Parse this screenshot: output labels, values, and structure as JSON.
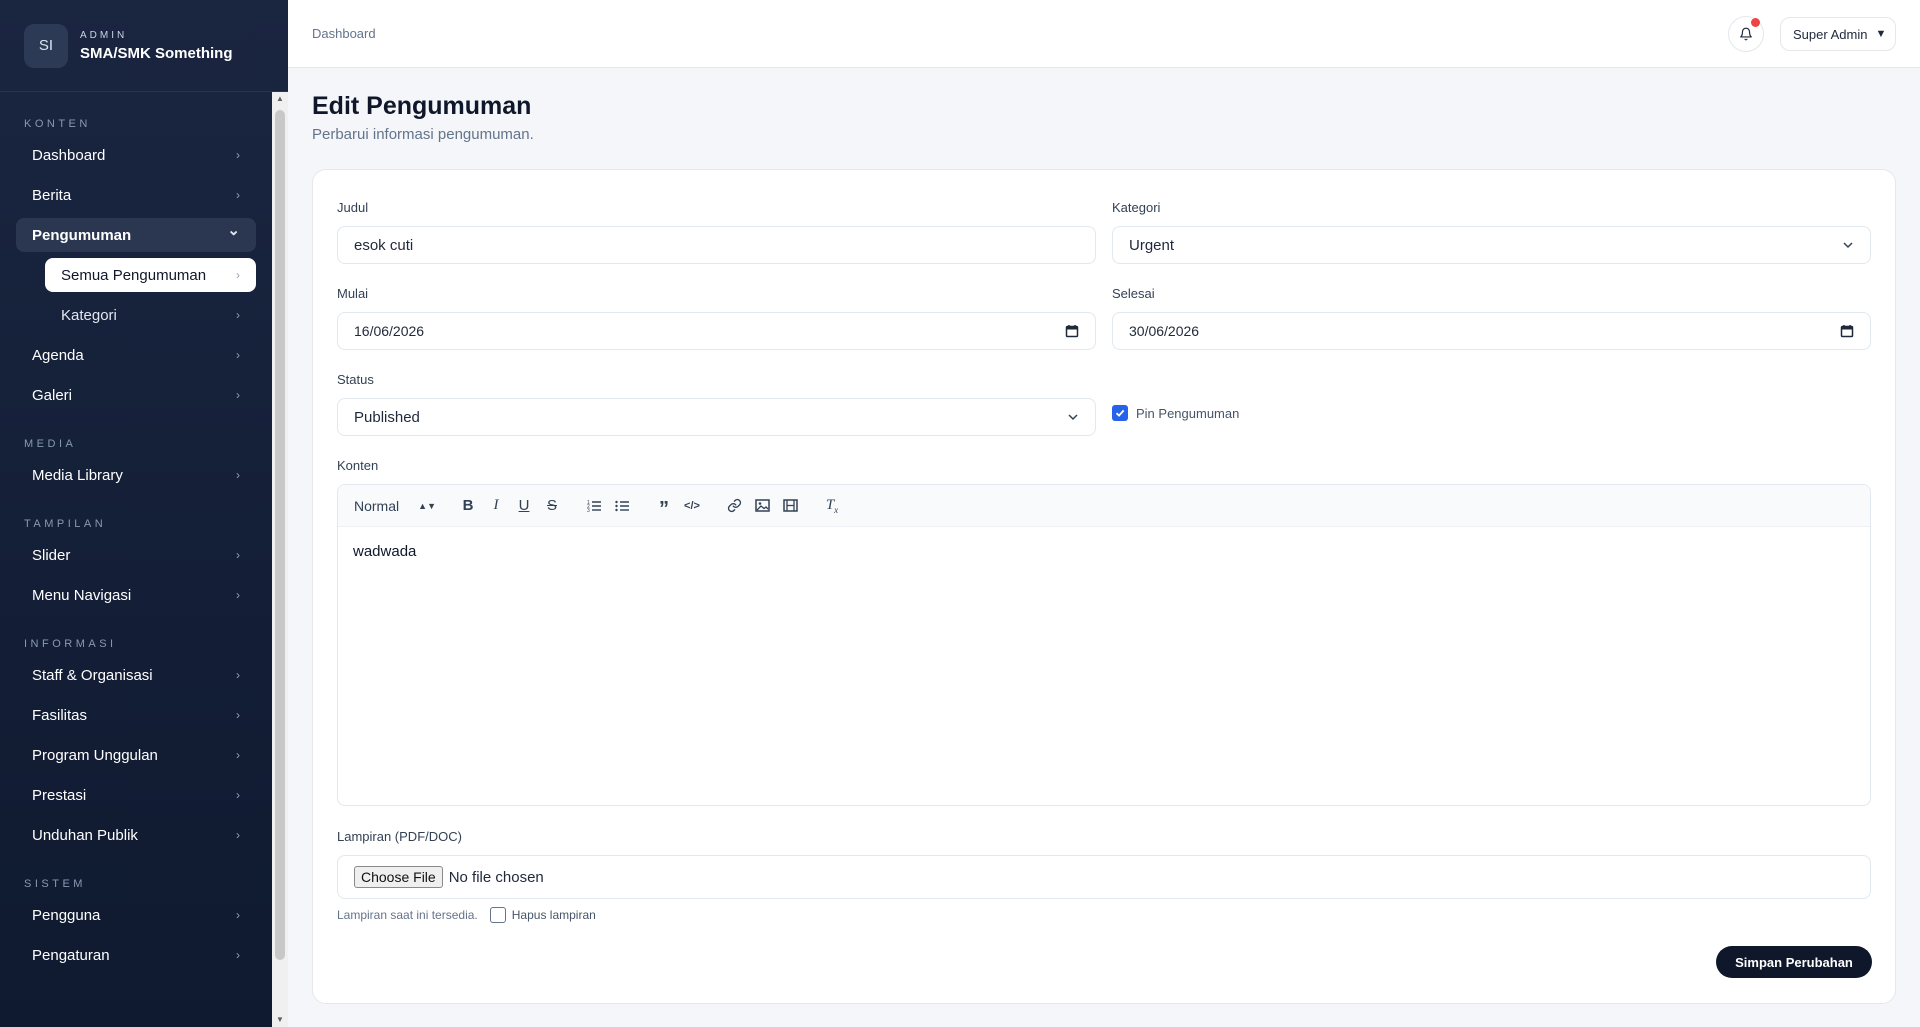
{
  "brand": {
    "logo": "SI",
    "small": "ADMIN",
    "name": "SMA/SMK Something"
  },
  "sidebar": {
    "sections": [
      {
        "title": "KONTEN",
        "items": [
          {
            "label": "Dashboard"
          },
          {
            "label": "Berita"
          },
          {
            "label": "Pengumuman",
            "active": true,
            "children": [
              {
                "label": "Semua Pengumuman",
                "selected": true
              },
              {
                "label": "Kategori"
              }
            ]
          },
          {
            "label": "Agenda"
          },
          {
            "label": "Galeri"
          }
        ]
      },
      {
        "title": "MEDIA",
        "items": [
          {
            "label": "Media Library"
          }
        ]
      },
      {
        "title": "TAMPILAN",
        "items": [
          {
            "label": "Slider"
          },
          {
            "label": "Menu Navigasi"
          }
        ]
      },
      {
        "title": "INFORMASI",
        "items": [
          {
            "label": "Staff & Organisasi"
          },
          {
            "label": "Fasilitas"
          },
          {
            "label": "Program Unggulan"
          },
          {
            "label": "Prestasi"
          },
          {
            "label": "Unduhan Publik"
          }
        ]
      },
      {
        "title": "SISTEM",
        "items": [
          {
            "label": "Pengguna"
          },
          {
            "label": "Pengaturan"
          }
        ]
      }
    ]
  },
  "topbar": {
    "breadcrumb": "Dashboard",
    "user": "Super Admin",
    "has_notification": true,
    "notification_color": "#ef4444"
  },
  "page": {
    "title": "Edit Pengumuman",
    "subtitle": "Perbarui informasi pengumuman."
  },
  "form": {
    "judul_label": "Judul",
    "judul_value": "esok cuti",
    "kategori_label": "Kategori",
    "kategori_value": "Urgent",
    "mulai_label": "Mulai",
    "mulai_value": "16/06/2026",
    "selesai_label": "Selesai",
    "selesai_value": "30/06/2026",
    "status_label": "Status",
    "status_value": "Published",
    "pin_label": "Pin Pengumuman",
    "pin_checked": true,
    "konten_label": "Konten",
    "editor_format": "Normal",
    "editor_content": "wadwada",
    "lampiran_label": "Lampiran (PDF/DOC)",
    "choose_file": "Choose File",
    "no_file": "No file chosen",
    "lampiran_note": "Lampiran saat ini tersedia.",
    "hapus_label": "Hapus lampiran",
    "hapus_checked": false,
    "save_label": "Simpan Perubahan"
  },
  "colors": {
    "sidebar_bg": "#1a2540",
    "accent": "#2563eb",
    "primary_button": "#0f172a"
  }
}
